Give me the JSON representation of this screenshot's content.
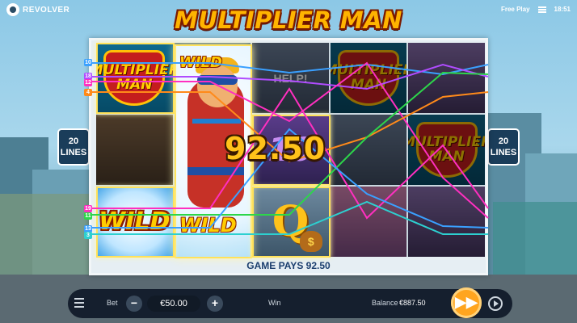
{
  "brand": {
    "name": "REVOLVER"
  },
  "status": {
    "mode": "Free Play",
    "time": "18:51"
  },
  "game": {
    "title": "MULTIPLIER MAN"
  },
  "reels": {
    "cells": [
      [
        "MULTIPLIER MAN",
        "WILD",
        "HELP!",
        "MULTIPLIER MAN",
        "MULTIPLIER MAN"
      ],
      [
        "",
        "",
        "10",
        "",
        "MULTIPLIER MAN"
      ],
      [
        "WILD",
        "WILD",
        "Q",
        "",
        ""
      ]
    ],
    "symbol_texts": {
      "mm_top": "MULTIPLIER MAN",
      "mm_mid": "MULTIPLIER MAN",
      "mm_right": "MULTIPLIER MAN",
      "wild": "WILD",
      "help": "HELP!",
      "ten": "10",
      "queen": "Q",
      "bag": "$"
    }
  },
  "win": {
    "amount": "92.50",
    "game_pays": "GAME PAYS 92.50"
  },
  "paylines": {
    "count_label_left": "20\nLINES",
    "left_markers": [
      {
        "n": "10",
        "color": "#3aa0ff"
      },
      {
        "n": "18",
        "color": "#b04cff"
      },
      {
        "n": "12",
        "color": "#ff2fc0"
      },
      {
        "n": "4",
        "color": "#ff8a1a"
      },
      {
        "n": "19",
        "color": "#ff2fc0"
      },
      {
        "n": "11",
        "color": "#2dd64a"
      },
      {
        "n": "13",
        "color": "#3aa0ff"
      },
      {
        "n": "3",
        "color": "#2dd0d0"
      }
    ]
  },
  "lines_badge": {
    "number": "20",
    "word": "LINES"
  },
  "controls": {
    "bet_label": "Bet",
    "bet_value": "€50.00",
    "minus": "−",
    "plus": "+",
    "win_label": "Win",
    "balance_label": "Balance",
    "balance_value": "€887.50",
    "spin": "▶▶"
  },
  "colors": {
    "accent": "#ffa51f",
    "title": "#ffb400",
    "frame": "#e6eef3"
  }
}
